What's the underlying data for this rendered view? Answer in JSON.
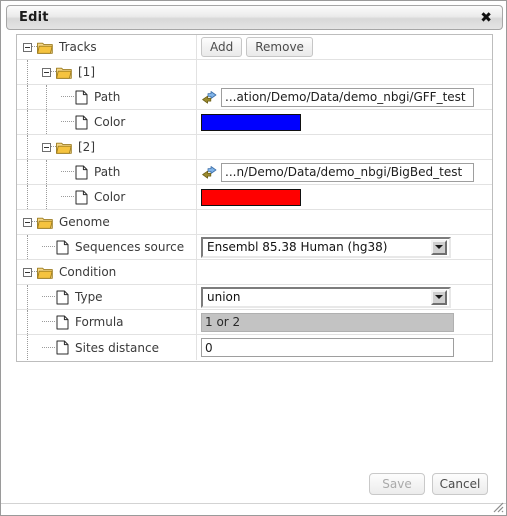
{
  "window": {
    "title": "Edit",
    "close_icon": "close-icon"
  },
  "tree": {
    "rows": [
      {
        "label": "Tracks",
        "icon": "folder-icon",
        "depth": 0,
        "kind": "folder",
        "value_type": "buttons"
      },
      {
        "label": "[1]",
        "icon": "folder-icon",
        "depth": 1,
        "kind": "folder",
        "value_type": "empty"
      },
      {
        "label": "Path",
        "icon": "file-icon",
        "depth": 2,
        "kind": "leaf",
        "value_type": "path",
        "value": "...ation/Demo/Data/demo_nbgi/GFF_test"
      },
      {
        "label": "Color",
        "icon": "file-icon",
        "depth": 2,
        "kind": "leaf",
        "value_type": "color",
        "value": "#0000FF"
      },
      {
        "label": "[2]",
        "icon": "folder-icon",
        "depth": 1,
        "kind": "folder",
        "value_type": "empty"
      },
      {
        "label": "Path",
        "icon": "file-icon",
        "depth": 2,
        "kind": "leaf",
        "value_type": "path",
        "value": "...n/Demo/Data/demo_nbgi/BigBed_test"
      },
      {
        "label": "Color",
        "icon": "file-icon",
        "depth": 2,
        "kind": "leaf",
        "value_type": "color",
        "value": "#FF0000"
      },
      {
        "label": "Genome",
        "icon": "folder-icon",
        "depth": 0,
        "kind": "folder",
        "value_type": "empty"
      },
      {
        "label": "Sequences source",
        "icon": "file-icon",
        "depth": 1,
        "kind": "leaf",
        "value_type": "select",
        "value": "Ensembl 85.38 Human (hg38)"
      },
      {
        "label": "Condition",
        "icon": "folder-icon",
        "depth": 0,
        "kind": "folder",
        "value_type": "empty"
      },
      {
        "label": "Type",
        "icon": "file-icon",
        "depth": 1,
        "kind": "leaf",
        "value_type": "select",
        "value": "union"
      },
      {
        "label": "Formula",
        "icon": "file-icon",
        "depth": 1,
        "kind": "leaf",
        "value_type": "input-disabled",
        "value": "1 or 2"
      },
      {
        "label": "Sites distance",
        "icon": "file-icon",
        "depth": 1,
        "kind": "leaf",
        "value_type": "input",
        "value": "0"
      }
    ]
  },
  "toolbar": {
    "add_label": "Add",
    "remove_label": "Remove"
  },
  "footer": {
    "save_label": "Save",
    "cancel_label": "Cancel",
    "resize_grip_icon": "resize-grip-icon"
  },
  "colors": {
    "track1_color": "#0000FF",
    "track2_color": "#FF0000",
    "disabled_field_bg": "#C3C3C3",
    "folder_icon": "#F2C14A",
    "titlebar_bg": "#E8E8E8"
  }
}
